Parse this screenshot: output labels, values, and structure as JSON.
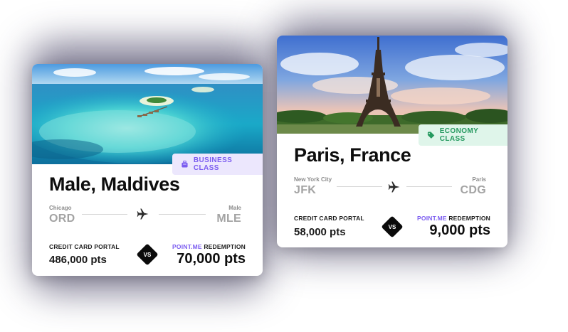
{
  "cards": [
    {
      "badge": "BUSINESS CLASS",
      "badge_icon": "suitcase-icon",
      "city": "Male, Maldives",
      "origin_city": "Chicago",
      "origin_code": "ORD",
      "dest_city": "Male",
      "dest_code": "MLE",
      "portal_label": "CREDIT CARD PORTAL",
      "portal_points": "486,000 pts",
      "vs": "VS",
      "brand": "POINT.ME",
      "redemption_label": "REDEMPTION",
      "redemption_points": "70,000 pts"
    },
    {
      "badge": "ECONOMY CLASS",
      "badge_icon": "tag-icon",
      "city": "Paris, France",
      "origin_city": "New York City",
      "origin_code": "JFK",
      "dest_city": "Paris",
      "dest_code": "CDG",
      "portal_label": "CREDIT CARD PORTAL",
      "portal_points": "58,000 pts",
      "vs": "VS",
      "brand": "POINT.ME",
      "redemption_label": "REDEMPTION",
      "redemption_points": "9,000 pts"
    }
  ],
  "colors": {
    "brand_purple": "#7b5cf0",
    "business_badge_bg": "#ece7fd",
    "economy_badge_bg": "#dff5ea",
    "economy_green": "#25995f",
    "shadow": "#1c1640"
  }
}
